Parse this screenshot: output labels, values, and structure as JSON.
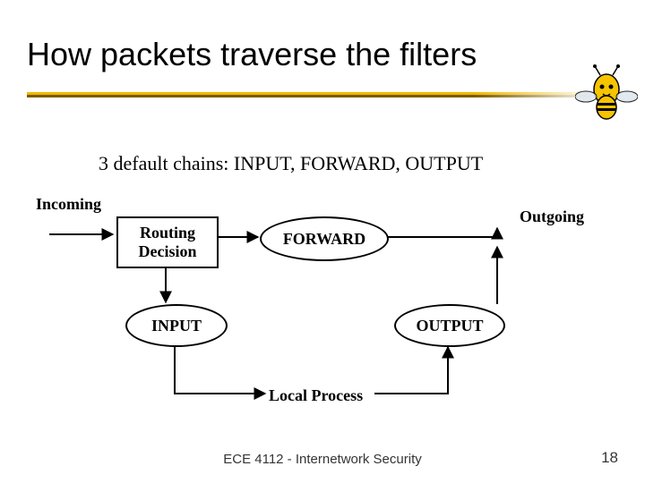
{
  "title": "How packets traverse the filters",
  "subtitle": "3 default chains:  INPUT, FORWARD, OUTPUT",
  "labels": {
    "incoming": "Incoming",
    "outgoing": "Outgoing",
    "local_process": "Local Process"
  },
  "nodes": {
    "routing_decision": "Routing\nDecision",
    "forward": "FORWARD",
    "input": "INPUT",
    "output": "OUTPUT"
  },
  "footer": "ECE 4112 - Internetwork Security",
  "slide_number": "18",
  "colors": {
    "underline_gold": "#f0b800",
    "underline_shadow": "#7a5a00"
  }
}
